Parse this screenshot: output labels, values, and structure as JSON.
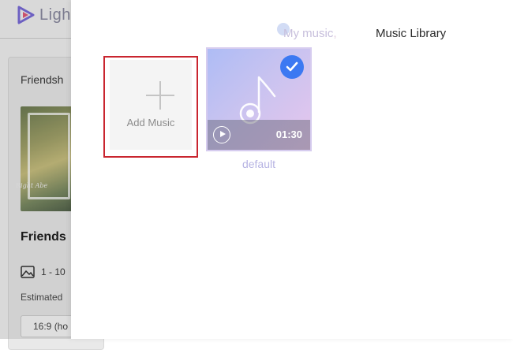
{
  "background": {
    "app_title": "Ligh",
    "card_title": "Friendsh",
    "thumbnail_caption": "Right Abe",
    "heading": "Friends",
    "stat": "1 - 10",
    "estimated_label": "Estimated",
    "ratio_value": "16:9 (ho"
  },
  "panel": {
    "tabs": {
      "my_music": "My music",
      "my_music_suffix": ",",
      "library": "Music Library"
    },
    "add_music_label": "Add Music",
    "tracks": [
      {
        "name": "default",
        "duration": "01:30",
        "selected": true
      }
    ]
  },
  "colors": {
    "accent_blue": "#3c79f2",
    "highlight_red": "#c9252f",
    "track_gradient_start": "#aebcf5",
    "track_gradient_end": "#e7c6ec"
  },
  "icons": [
    "logo-icon",
    "image-icon",
    "plus-icon",
    "music-note-icon",
    "check-icon",
    "play-icon"
  ]
}
